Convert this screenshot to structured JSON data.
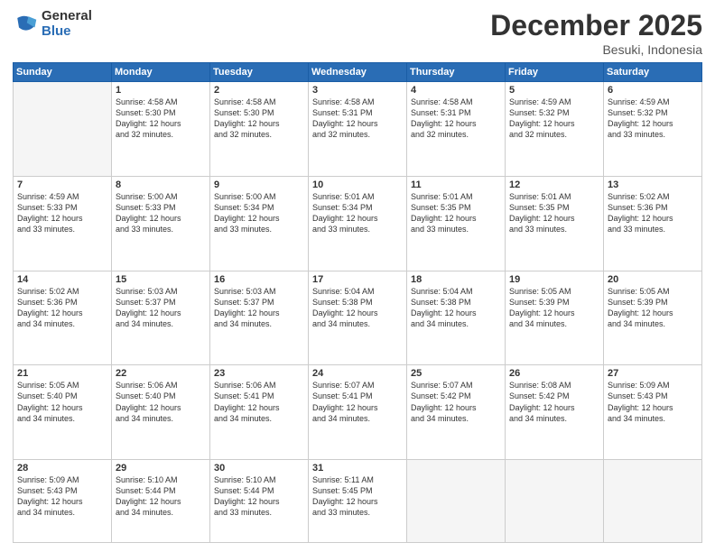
{
  "logo": {
    "general": "General",
    "blue": "Blue"
  },
  "title": "December 2025",
  "location": "Besuki, Indonesia",
  "weekdays": [
    "Sunday",
    "Monday",
    "Tuesday",
    "Wednesday",
    "Thursday",
    "Friday",
    "Saturday"
  ],
  "weeks": [
    [
      {
        "day": "",
        "info": ""
      },
      {
        "day": "1",
        "info": "Sunrise: 4:58 AM\nSunset: 5:30 PM\nDaylight: 12 hours\nand 32 minutes."
      },
      {
        "day": "2",
        "info": "Sunrise: 4:58 AM\nSunset: 5:30 PM\nDaylight: 12 hours\nand 32 minutes."
      },
      {
        "day": "3",
        "info": "Sunrise: 4:58 AM\nSunset: 5:31 PM\nDaylight: 12 hours\nand 32 minutes."
      },
      {
        "day": "4",
        "info": "Sunrise: 4:58 AM\nSunset: 5:31 PM\nDaylight: 12 hours\nand 32 minutes."
      },
      {
        "day": "5",
        "info": "Sunrise: 4:59 AM\nSunset: 5:32 PM\nDaylight: 12 hours\nand 32 minutes."
      },
      {
        "day": "6",
        "info": "Sunrise: 4:59 AM\nSunset: 5:32 PM\nDaylight: 12 hours\nand 33 minutes."
      }
    ],
    [
      {
        "day": "7",
        "info": "Sunrise: 4:59 AM\nSunset: 5:33 PM\nDaylight: 12 hours\nand 33 minutes."
      },
      {
        "day": "8",
        "info": "Sunrise: 5:00 AM\nSunset: 5:33 PM\nDaylight: 12 hours\nand 33 minutes."
      },
      {
        "day": "9",
        "info": "Sunrise: 5:00 AM\nSunset: 5:34 PM\nDaylight: 12 hours\nand 33 minutes."
      },
      {
        "day": "10",
        "info": "Sunrise: 5:01 AM\nSunset: 5:34 PM\nDaylight: 12 hours\nand 33 minutes."
      },
      {
        "day": "11",
        "info": "Sunrise: 5:01 AM\nSunset: 5:35 PM\nDaylight: 12 hours\nand 33 minutes."
      },
      {
        "day": "12",
        "info": "Sunrise: 5:01 AM\nSunset: 5:35 PM\nDaylight: 12 hours\nand 33 minutes."
      },
      {
        "day": "13",
        "info": "Sunrise: 5:02 AM\nSunset: 5:36 PM\nDaylight: 12 hours\nand 33 minutes."
      }
    ],
    [
      {
        "day": "14",
        "info": "Sunrise: 5:02 AM\nSunset: 5:36 PM\nDaylight: 12 hours\nand 34 minutes."
      },
      {
        "day": "15",
        "info": "Sunrise: 5:03 AM\nSunset: 5:37 PM\nDaylight: 12 hours\nand 34 minutes."
      },
      {
        "day": "16",
        "info": "Sunrise: 5:03 AM\nSunset: 5:37 PM\nDaylight: 12 hours\nand 34 minutes."
      },
      {
        "day": "17",
        "info": "Sunrise: 5:04 AM\nSunset: 5:38 PM\nDaylight: 12 hours\nand 34 minutes."
      },
      {
        "day": "18",
        "info": "Sunrise: 5:04 AM\nSunset: 5:38 PM\nDaylight: 12 hours\nand 34 minutes."
      },
      {
        "day": "19",
        "info": "Sunrise: 5:05 AM\nSunset: 5:39 PM\nDaylight: 12 hours\nand 34 minutes."
      },
      {
        "day": "20",
        "info": "Sunrise: 5:05 AM\nSunset: 5:39 PM\nDaylight: 12 hours\nand 34 minutes."
      }
    ],
    [
      {
        "day": "21",
        "info": "Sunrise: 5:05 AM\nSunset: 5:40 PM\nDaylight: 12 hours\nand 34 minutes."
      },
      {
        "day": "22",
        "info": "Sunrise: 5:06 AM\nSunset: 5:40 PM\nDaylight: 12 hours\nand 34 minutes."
      },
      {
        "day": "23",
        "info": "Sunrise: 5:06 AM\nSunset: 5:41 PM\nDaylight: 12 hours\nand 34 minutes."
      },
      {
        "day": "24",
        "info": "Sunrise: 5:07 AM\nSunset: 5:41 PM\nDaylight: 12 hours\nand 34 minutes."
      },
      {
        "day": "25",
        "info": "Sunrise: 5:07 AM\nSunset: 5:42 PM\nDaylight: 12 hours\nand 34 minutes."
      },
      {
        "day": "26",
        "info": "Sunrise: 5:08 AM\nSunset: 5:42 PM\nDaylight: 12 hours\nand 34 minutes."
      },
      {
        "day": "27",
        "info": "Sunrise: 5:09 AM\nSunset: 5:43 PM\nDaylight: 12 hours\nand 34 minutes."
      }
    ],
    [
      {
        "day": "28",
        "info": "Sunrise: 5:09 AM\nSunset: 5:43 PM\nDaylight: 12 hours\nand 34 minutes."
      },
      {
        "day": "29",
        "info": "Sunrise: 5:10 AM\nSunset: 5:44 PM\nDaylight: 12 hours\nand 34 minutes."
      },
      {
        "day": "30",
        "info": "Sunrise: 5:10 AM\nSunset: 5:44 PM\nDaylight: 12 hours\nand 33 minutes."
      },
      {
        "day": "31",
        "info": "Sunrise: 5:11 AM\nSunset: 5:45 PM\nDaylight: 12 hours\nand 33 minutes."
      },
      {
        "day": "",
        "info": ""
      },
      {
        "day": "",
        "info": ""
      },
      {
        "day": "",
        "info": ""
      }
    ]
  ]
}
